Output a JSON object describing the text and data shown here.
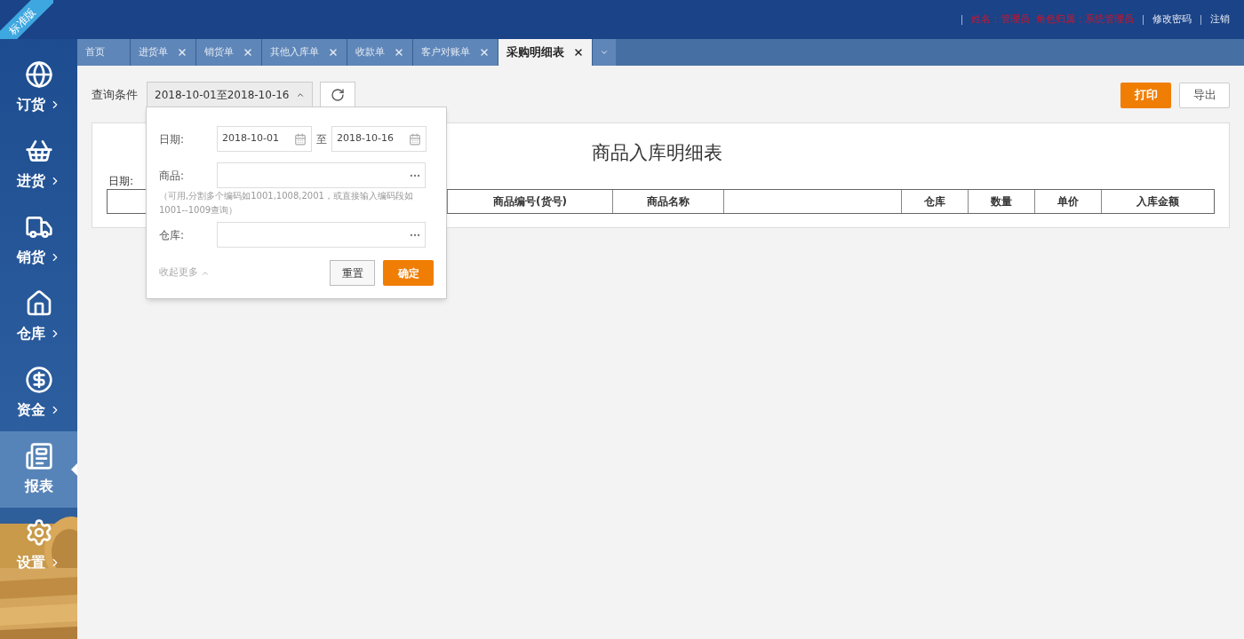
{
  "edition_ribbon": "标准版",
  "header": {
    "user_info": "姓名：管理员  角色归属：系统管理员",
    "links": [
      "修改密码",
      "注销"
    ]
  },
  "sidebar": {
    "items": [
      {
        "kind": "globe",
        "label": "订货",
        "arrow": true,
        "selected": false
      },
      {
        "kind": "basket",
        "label": "进货",
        "arrow": true,
        "selected": false
      },
      {
        "kind": "cart",
        "label": "销货",
        "arrow": true,
        "selected": false
      },
      {
        "kind": "house",
        "label": "仓库",
        "arrow": true,
        "selected": false
      },
      {
        "kind": "coin",
        "label": "资金",
        "arrow": true,
        "selected": false
      },
      {
        "kind": "report",
        "label": "报表",
        "arrow": false,
        "selected": true
      },
      {
        "kind": "gear",
        "label": "设置",
        "arrow": true,
        "selected": false
      }
    ]
  },
  "tabs": [
    {
      "label": "首页",
      "closable": false,
      "selected": false
    },
    {
      "label": "进货单",
      "closable": true,
      "selected": false
    },
    {
      "label": "销货单",
      "closable": true,
      "selected": false
    },
    {
      "label": "其他入库单",
      "closable": true,
      "selected": false
    },
    {
      "label": "收款单",
      "closable": true,
      "selected": false
    },
    {
      "label": "客户对账单",
      "closable": true,
      "selected": false
    },
    {
      "label": "采购明细表",
      "closable": true,
      "selected": true
    }
  ],
  "toolbar": {
    "query_label": "查询条件",
    "query_value": "2018-10-01至2018-10-16",
    "buttons": [
      {
        "label": "打印",
        "primary": true
      },
      {
        "label": "导出",
        "primary": false
      }
    ]
  },
  "filter_popup": {
    "date_label": "日期:",
    "date_from": "2018-10-01",
    "date_sep": "至",
    "date_to": "2018-10-16",
    "goods_label": "商品:",
    "goods_hint": "（可用,分割多个编码如1001,1008,2001，或直接输入编码段如1001--1009查询）",
    "warehouse_label": "仓库:",
    "collapse_link": "收起更多",
    "reset": "重置",
    "confirm": "确定"
  },
  "report": {
    "title": "商品入库明细表",
    "date_label": "日期:",
    "columns": [
      "商品编号(货号)",
      "商品名称",
      "",
      "仓库",
      "数量",
      "单价",
      "入库金额"
    ]
  }
}
